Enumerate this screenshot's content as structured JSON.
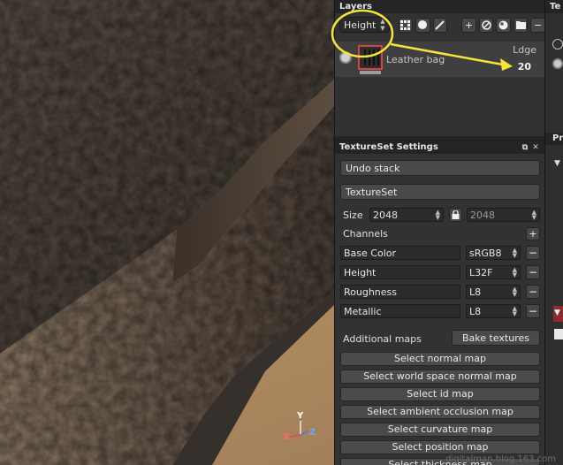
{
  "layers_panel": {
    "title": "Layers",
    "channel_select": "Height",
    "toolbar_icons": [
      "paint-layer-icon",
      "fill-layer-icon",
      "mask-icon",
      "add-icon",
      "effects-icon",
      "material-icon",
      "folder-icon",
      "delete-icon"
    ],
    "layer": {
      "name": "Leather bag",
      "blend_mode": "Ldge",
      "opacity": "20"
    }
  },
  "textureset_settings": {
    "title": "TextureSet Settings",
    "undo_stack_label": "Undo stack",
    "textureset_label": "TextureSet",
    "size_label": "Size",
    "size_width": "2048",
    "size_height": "2048",
    "channels_label": "Channels",
    "channels": [
      {
        "name": "Base Color",
        "format": "sRGB8"
      },
      {
        "name": "Height",
        "format": "L32F"
      },
      {
        "name": "Roughness",
        "format": "L8"
      },
      {
        "name": "Metallic",
        "format": "L8"
      }
    ],
    "additional_maps_label": "Additional maps",
    "bake_textures_label": "Bake textures",
    "map_buttons": [
      "Select normal map",
      "Select world space normal map",
      "Select id map",
      "Select ambient occlusion map",
      "Select curvature map",
      "Select position map",
      "Select thickness map"
    ]
  },
  "side_panel": {
    "title_fragment": "Te",
    "properties_fragment": "Pro"
  },
  "viewport": {
    "axis_x": "X",
    "axis_y": "Y",
    "axis_z": "Z"
  },
  "watermark": "digitalman.blog.163.com",
  "colors": {
    "annotation": "#f3e53a",
    "panel": "#323232",
    "selection_red": "#d34545"
  }
}
